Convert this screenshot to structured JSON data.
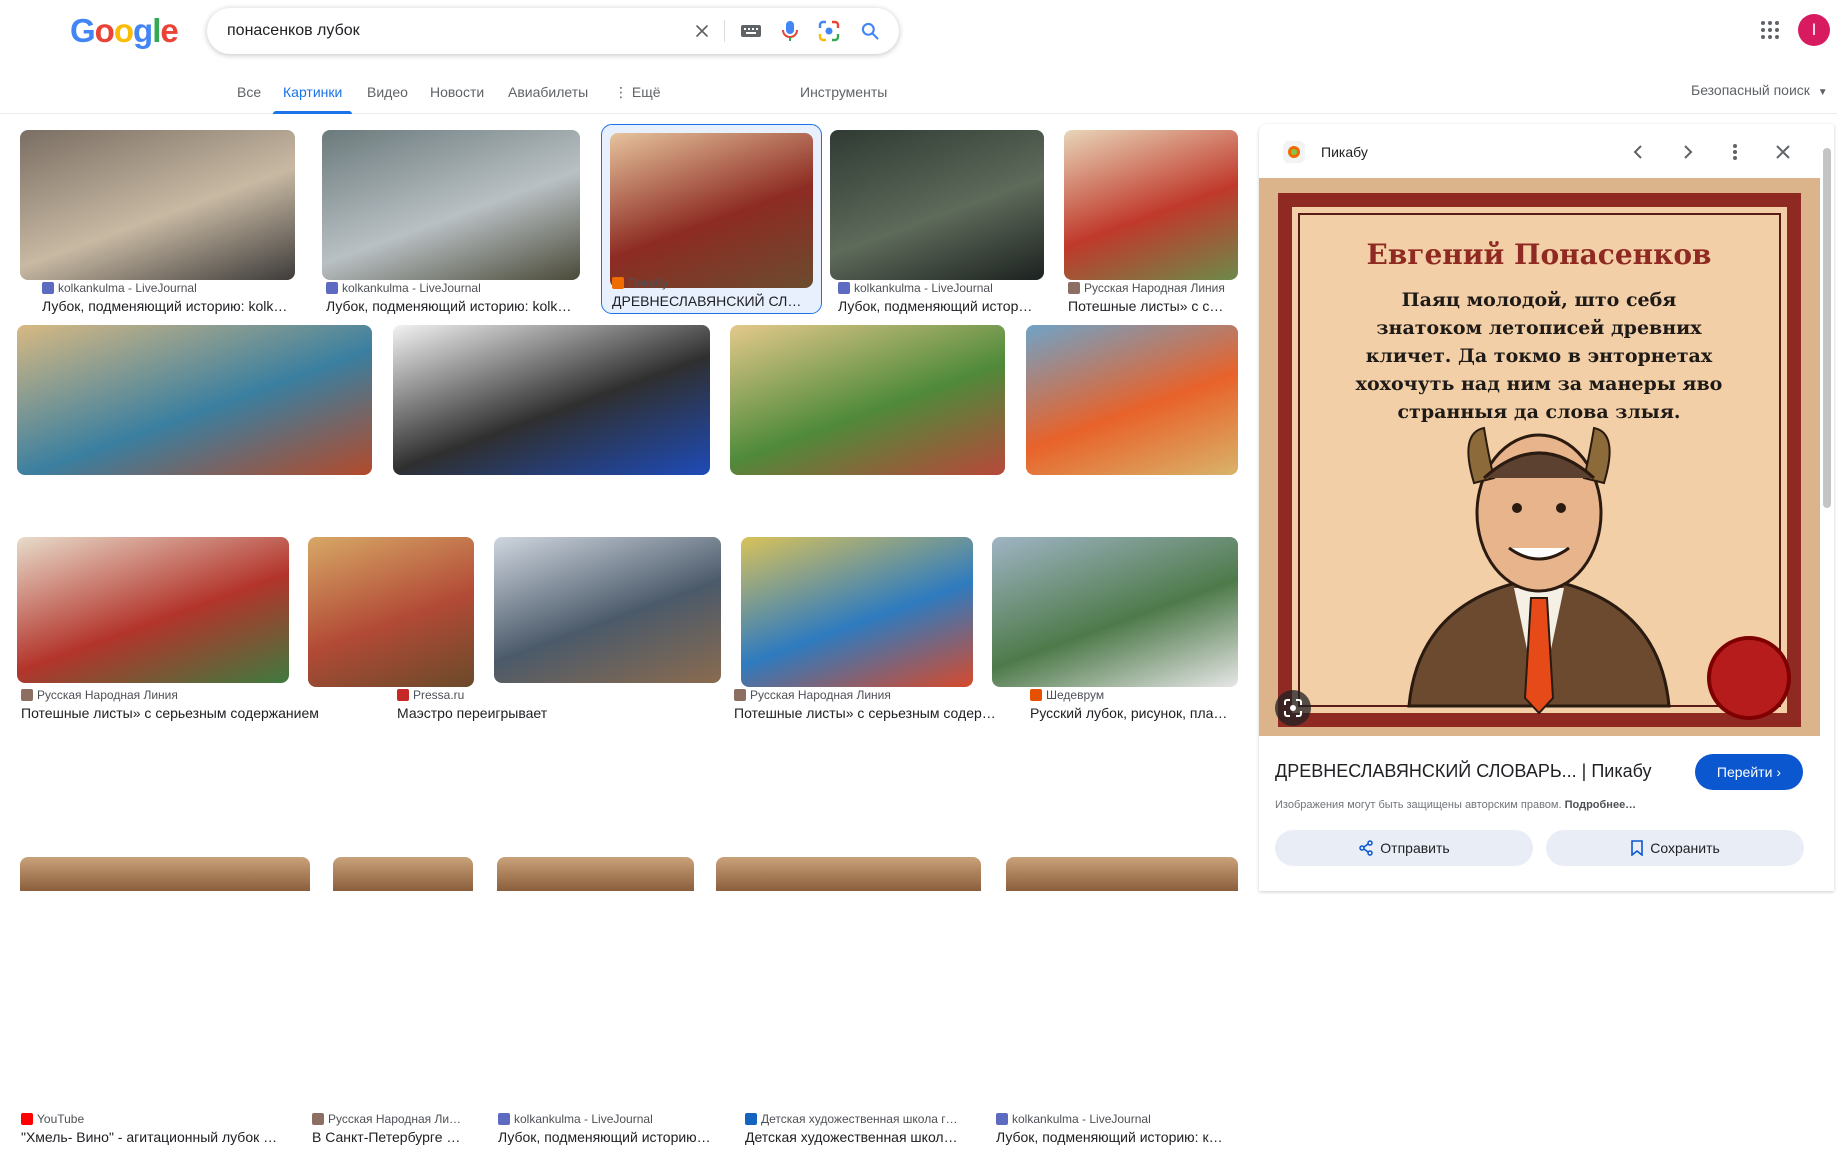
{
  "header": {
    "logo": [
      "G",
      "o",
      "o",
      "g",
      "l",
      "e"
    ],
    "logo_colors": [
      "#4285f4",
      "#ea4335",
      "#fbbc05",
      "#4285f4",
      "#34a853",
      "#ea4335"
    ],
    "search_value": "понасенков лубок",
    "avatar_letter": "I"
  },
  "tabs": [
    {
      "label": "Все"
    },
    {
      "label": "Картинки"
    },
    {
      "label": "Видео"
    },
    {
      "label": "Новости"
    },
    {
      "label": "Авиабилеты"
    },
    {
      "label": "⋮ Ещё"
    },
    {
      "label": "Инструменты"
    }
  ],
  "safe_search": "Безопасный поиск",
  "results": [
    {
      "source": "kolkankulma - LiveJournal",
      "title": "Лубок, подменяющий историю: kolkank…",
      "fav": "#5c6bc0",
      "colors": [
        "#7a6e63",
        "#c8b9a3",
        "#3d3b3a"
      ]
    },
    {
      "source": "kolkankulma - LiveJournal",
      "title": "Лубок, подменяющий историю: kolk…",
      "fav": "#5c6bc0",
      "colors": [
        "#6b7a7c",
        "#b9c0c4",
        "#4a4a38"
      ]
    },
    {
      "source": "Пикабу",
      "title": "ДРЕВНЕСЛАВЯНСКИЙ СЛ…",
      "fav": "#ef6c00",
      "colors": [
        "#e6c39d",
        "#8d2b22",
        "#6b4c2f"
      ]
    },
    {
      "source": "kolkankulma - LiveJournal",
      "title": "Лубок, подменяющий истор…",
      "fav": "#5c6bc0",
      "colors": [
        "#2f3a33",
        "#5e6a5a",
        "#1c2220"
      ]
    },
    {
      "source": "Русская Народная Линия",
      "title": "Потешные листы» с с…",
      "fav": "#8d6e63",
      "colors": [
        "#e8d6b9",
        "#c0392b",
        "#6d8a4a"
      ]
    },
    {
      "source": "Русская Народная Линия",
      "title": "Потешные листы» с серьезным содержанием",
      "fav": "#8d6e63",
      "colors": [
        "#d8b982",
        "#3a7fa0",
        "#b34a2a"
      ]
    },
    {
      "source": "Pressa.ru",
      "title": "Маэстро переигрывает",
      "fav": "#c62828",
      "colors": [
        "#f2f2f2",
        "#2f2f2f",
        "#1e4bb8"
      ]
    },
    {
      "source": "Русская Народная Линия",
      "title": "Потешные листы» с серьезным содер…",
      "fav": "#8d6e63",
      "colors": [
        "#e4c98b",
        "#4f8a3a",
        "#b8483a"
      ]
    },
    {
      "source": "Шедеврум",
      "title": "Русский лубок, рисунок, пла…",
      "fav": "#e65100",
      "colors": [
        "#6fa3c7",
        "#e8622a",
        "#d9b36a"
      ]
    },
    {
      "source": "YouTube",
      "title": "\"Хмель- Вино\" - агитационный лубок …",
      "fav": "#ff0000",
      "colors": [
        "#e8dccb",
        "#b3342b",
        "#3f7a3f"
      ]
    },
    {
      "source": "Русская Народная Ли…",
      "title": "В Санкт-Петербурге …",
      "fav": "#8d6e63",
      "colors": [
        "#d7a866",
        "#b24a36",
        "#6a4a2a"
      ]
    },
    {
      "source": "kolkankulma - LiveJournal",
      "title": "Лубок, подменяющий историю…",
      "fav": "#5c6bc0",
      "colors": [
        "#cfd6df",
        "#4b5a6a",
        "#8a6b4f"
      ]
    },
    {
      "source": "Детская художественная школа г…",
      "title": "Детская художественная школ…",
      "fav": "#1565c0",
      "colors": [
        "#d9c25a",
        "#2e7bbf",
        "#d64a2c"
      ]
    },
    {
      "source": "kolkankulma - LiveJournal",
      "title": "Лубок, подменяющий историю: к…",
      "fav": "#5c6bc0",
      "colors": [
        "#9fb4c4",
        "#4e7a4a",
        "#e6e6e6"
      ]
    }
  ],
  "panel": {
    "site": "Пикабу",
    "image_heading": "Евгений Понасенков",
    "image_text": [
      "Паяц молодой, што себя",
      "знатоком летописей древних",
      "кличет. Да токмо в энторнетах",
      "хохочуть над ним за манеры яво",
      "странныя да слова злыя."
    ],
    "title": "ДРЕВНЕСЛАВЯНСКИЙ СЛОВАРЬ... | Пикабу",
    "goto": "Перейти",
    "copyright_text": "Изображения могут быть защищены авторским правом.",
    "copyright_more": "Подробнее…",
    "share": "Отправить",
    "save": "Сохранить"
  }
}
